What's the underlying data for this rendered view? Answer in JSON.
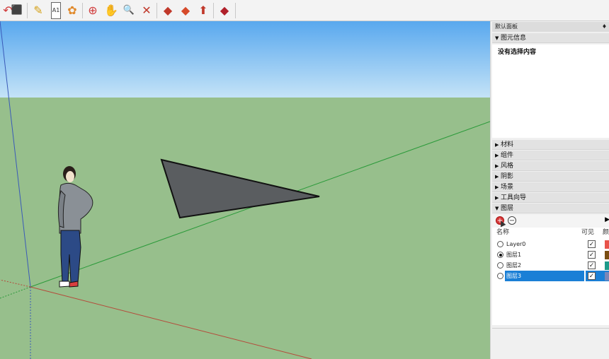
{
  "toolbar": {
    "icons": [
      {
        "name": "undo-icon",
        "glyph": "↶",
        "color": "#d03a3a"
      },
      {
        "name": "export-icon",
        "glyph": "⬛",
        "color": "#c0392b"
      },
      {
        "name": "paint-bucket-icon",
        "glyph": "✎",
        "color": "#d4a017"
      },
      {
        "name": "text-icon",
        "glyph": "A1",
        "color": "#333333"
      },
      {
        "name": "paint-icon",
        "glyph": "✿",
        "color": "#e08a2c"
      },
      {
        "name": "orbit-icon",
        "glyph": "⊕",
        "color": "#d03a3a"
      },
      {
        "name": "pan-icon",
        "glyph": "✋",
        "color": "#e0b070"
      },
      {
        "name": "zoom-icon",
        "glyph": "🔍",
        "color": "#1f5fa0"
      },
      {
        "name": "zoom-extents-icon",
        "glyph": "✕",
        "color": "#c0392b"
      },
      {
        "name": "warehouse-icon",
        "glyph": "◆",
        "color": "#c0392b"
      },
      {
        "name": "component-icon",
        "glyph": "◆",
        "color": "#d64a2a"
      },
      {
        "name": "share-icon",
        "glyph": "⬆",
        "color": "#c0392b"
      },
      {
        "name": "ruby-icon",
        "glyph": "◆",
        "color": "#b0202a"
      }
    ]
  },
  "panel": {
    "title": "默认面板",
    "pin": "♦",
    "entity_info_label": "图元信息",
    "entity_info_text": "没有选择内容",
    "sections": [
      "材料",
      "组件",
      "风格",
      "阴影",
      "场景",
      "工具向导",
      "图层"
    ],
    "layers": {
      "add_glyph": "+",
      "remove_glyph": "−",
      "menu_glyph": "▶",
      "col_name": "名称",
      "col_visible": "可见",
      "col_color": "颜",
      "rows": [
        {
          "name": "Layer0",
          "active": false,
          "visible": true,
          "color": "#e8534a",
          "selected": false
        },
        {
          "name": "图层1",
          "active": true,
          "visible": true,
          "color": "#7a4e12",
          "selected": false
        },
        {
          "name": "图层2",
          "active": false,
          "visible": true,
          "color": "#1e9a8a",
          "selected": false
        },
        {
          "name": "图层3",
          "active": false,
          "visible": true,
          "color": "#7a86b8",
          "selected": true
        }
      ]
    }
  },
  "scene": {
    "sky_top": "#59a8ee",
    "sky_bottom": "#bfe0f6",
    "ground": "#97bf8c",
    "triangle_fill": "#5a5d60"
  }
}
